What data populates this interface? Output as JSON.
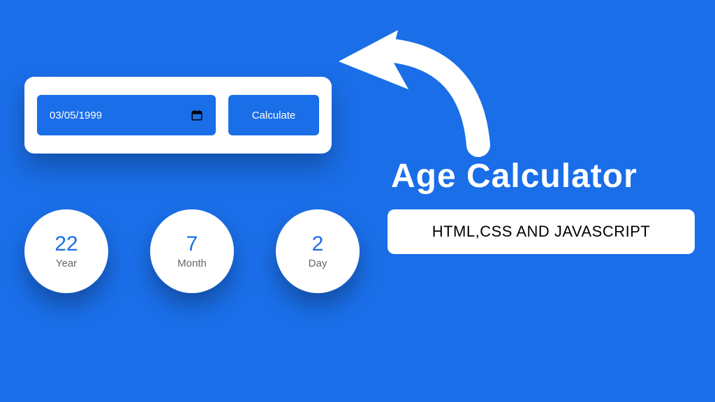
{
  "calculator": {
    "date_value": "03/05/1999",
    "button_label": "Calculate"
  },
  "results": {
    "year_value": "22",
    "year_label": "Year",
    "month_value": "7",
    "month_label": "Month",
    "day_value": "2",
    "day_label": "Day"
  },
  "heading": {
    "title": "Age Calculator",
    "subtitle": "HTML,CSS  AND JAVASCRIPT"
  }
}
